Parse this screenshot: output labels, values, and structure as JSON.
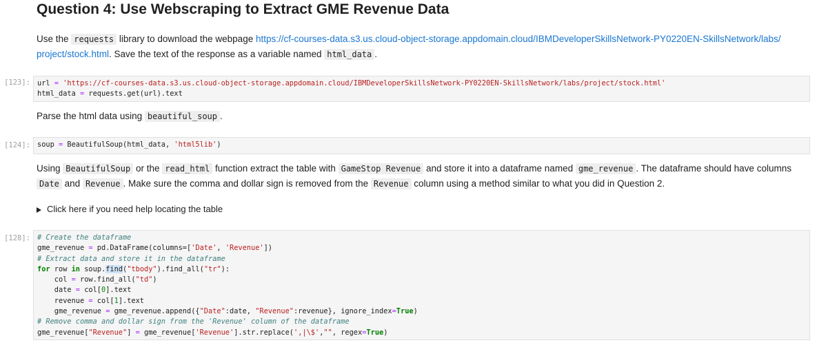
{
  "heading": "Question 4: Use Webscraping to Extract GME Revenue Data",
  "p1": {
    "t1": "Use the ",
    "c1": "requests",
    "t2": " library to download the webpage ",
    "link": "https://cf-courses-data.s3.us.cloud-object-storage.appdomain.cloud/IBMDeveloperSkillsNetwork-PY0220EN-SkillsNetwork/labs/project/stock.html",
    "t3": ". Save the text of the response as a variable named ",
    "c2": "html_data",
    "t4": "."
  },
  "cell1": {
    "prompt": "[123]:",
    "line1_a": "url ",
    "line1_eq": "=",
    "line1_str": " 'https://cf-courses-data.s3.us.cloud-object-storage.appdomain.cloud/IBMDeveloperSkillsNetwork-PY0220EN-SkillsNetwork/labs/project/stock.html'",
    "line2_a": "html_data ",
    "line2_eq": "=",
    "line2_b": " requests.get(url).text"
  },
  "p2": {
    "t1": "Parse the html data using ",
    "c1": "beautiful_soup",
    "t2": "."
  },
  "cell2": {
    "prompt": "[124]:",
    "a": "soup ",
    "eq": "=",
    "b": " BeautifulSoup(html_data, ",
    "str": "'html5lib'",
    "c": ")"
  },
  "p3": {
    "t1": "Using ",
    "c1": "BeautifulSoup",
    "t2": " or the ",
    "c2": "read_html",
    "t3": " function extract the table with ",
    "c3": "GameStop Revenue",
    "t4": " and store it into a dataframe named ",
    "c4": "gme_revenue",
    "t5": ". The dataframe should have columns ",
    "c5": "Date",
    "t6": " and ",
    "c6": "Revenue",
    "t7": ". Make sure the comma and dollar sign is removed from the ",
    "c7": "Revenue",
    "t8": " column using a method similar to what you did in Question 2."
  },
  "details_summary": "Click here if you need help locating the table",
  "cell3": {
    "prompt": "[128]:",
    "l1": "# Create the dataframe",
    "l2_a": "gme_revenue ",
    "l2_eq": "=",
    "l2_b": " pd.DataFrame(columns=[",
    "l2_s1": "'Date'",
    "l2_c": ", ",
    "l2_s2": "'Revenue'",
    "l2_d": "])",
    "l3": "# Extract data and store it in the dataframe",
    "l4_kw1": "for",
    "l4_a": " row ",
    "l4_kw2": "in",
    "l4_b": " soup.",
    "l4_hl": "find",
    "l4_c": "(",
    "l4_s1": "\"tbody\"",
    "l4_d": ").find_all(",
    "l4_s2": "\"tr\"",
    "l4_e": "):",
    "l5_a": "    col ",
    "l5_eq": "=",
    "l5_b": " row.find_all(",
    "l5_s": "\"td\"",
    "l5_c": ")",
    "l6_a": "    date ",
    "l6_eq": "=",
    "l6_b": " col[",
    "l6_n": "0",
    "l6_c": "].text",
    "l7_a": "    revenue ",
    "l7_eq": "=",
    "l7_b": " col[",
    "l7_n": "1",
    "l7_c": "].text",
    "l8_a": "    gme_revenue ",
    "l8_eq": "=",
    "l8_b": " gme_revenue.append({",
    "l8_s1": "\"Date\"",
    "l8_c": ":date, ",
    "l8_s2": "\"Revenue\"",
    "l8_d": ":revenue}, ignore_index",
    "l8_eq2": "=",
    "l8_kw": "True",
    "l8_e": ")",
    "l9": "# Remove comma and dollar sign from the 'Revenue' column of the dataframe",
    "l10_a": "gme_revenue[",
    "l10_s1": "\"Revenue\"",
    "l10_b": "] ",
    "l10_eq": "=",
    "l10_c": " gme_revenue[",
    "l10_s2": "'Revenue'",
    "l10_d": "].str.replace(",
    "l10_s3": "',|\\$'",
    "l10_e": ",",
    "l10_s4": "\"\"",
    "l10_f": ", regex",
    "l10_eq2": "=",
    "l10_kw": "True",
    "l10_g": ")"
  }
}
